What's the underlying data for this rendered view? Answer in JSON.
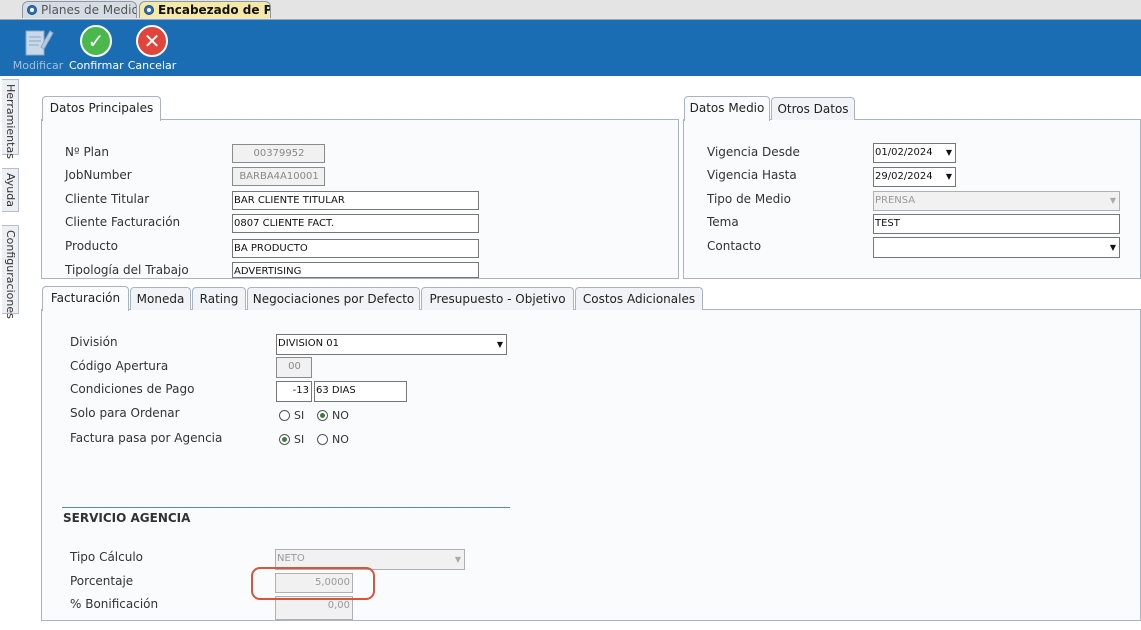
{
  "doc_tabs": [
    "Planes de Medio",
    "Encabezado de Plan"
  ],
  "toolbar": {
    "modify": "Modificar",
    "confirm": "Confirmar",
    "cancel": "Cancelar"
  },
  "sidebar": [
    "Herramientas",
    "Ayuda",
    "Configuraciones"
  ],
  "datos_principales": {
    "tab": "Datos Principales",
    "fields": [
      {
        "label": "Nº Plan",
        "value": "00379952"
      },
      {
        "label": "JobNumber",
        "value": "BARBA4A10001"
      },
      {
        "label": "Cliente Titular",
        "value": "BAR CLIENTE TITULAR"
      },
      {
        "label": "Cliente Facturación",
        "value": "0807 CLIENTE FACT."
      },
      {
        "label": "Producto",
        "value": "BA PRODUCTO"
      },
      {
        "label": "Tipología del Trabajo",
        "value": "ADVERTISING"
      }
    ]
  },
  "datos_medio": {
    "tabs": [
      "Datos Medio",
      "Otros Datos"
    ],
    "fields": [
      {
        "label": "Vigencia Desde",
        "value": "01/02/2024"
      },
      {
        "label": "Vigencia Hasta",
        "value": "29/02/2024"
      },
      {
        "label": "Tipo de Medio",
        "value": "PRENSA"
      },
      {
        "label": "Tema",
        "value": "TEST"
      },
      {
        "label": "Contacto",
        "value": ""
      }
    ]
  },
  "bottom_tabs": [
    "Facturación",
    "Moneda",
    "Rating",
    "Negociaciones por Defecto",
    "Presupuesto - Objetivo",
    "Costos Adicionales"
  ],
  "facturacion": {
    "division_label": "División",
    "division_value": "DIVISION 01",
    "codigo_label": "Código Apertura",
    "codigo_value": "00",
    "condiciones_label": "Condiciones de Pago",
    "condiciones_code": "-13",
    "condiciones_text": "63 DIAS",
    "solo_label": "Solo para Ordenar",
    "factura_label": "Factura pasa por Agencia",
    "si": "SI",
    "no": "NO"
  },
  "servicio": {
    "heading": "SERVICIO AGENCIA",
    "tipo_label": "Tipo Cálculo",
    "tipo_value": "NETO",
    "porcentaje_label": "Porcentaje",
    "porcentaje_value": "5,0000",
    "bonificacion_label": "% Bonificación",
    "bonificacion_value": "0,00"
  },
  "colors": {
    "toolbar": "#1a6db3",
    "highlight": "#d9533e",
    "active_doc_tab": "#f5e9a8"
  }
}
